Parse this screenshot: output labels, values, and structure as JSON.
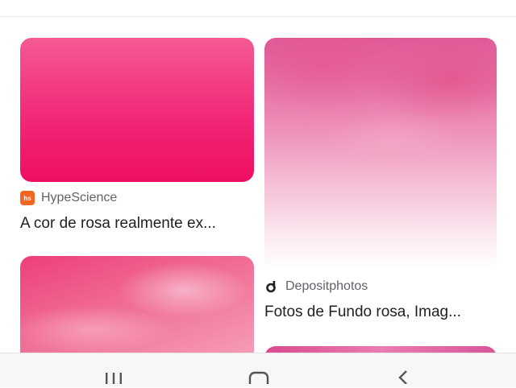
{
  "results": [
    {
      "source": "HypeScience",
      "favicon": "hypescience-favicon",
      "title": "A cor de rosa realmente ex..."
    },
    {
      "source": "Depositphotos",
      "favicon": "depositphotos-favicon",
      "title": "Fotos de Fundo rosa, Imag..."
    }
  ],
  "navigation": {
    "icons": [
      "recent-apps-icon",
      "home-icon",
      "back-icon"
    ]
  },
  "colors": {
    "accent_pink": "#f22878",
    "hypescience_orange": "#f26522"
  }
}
